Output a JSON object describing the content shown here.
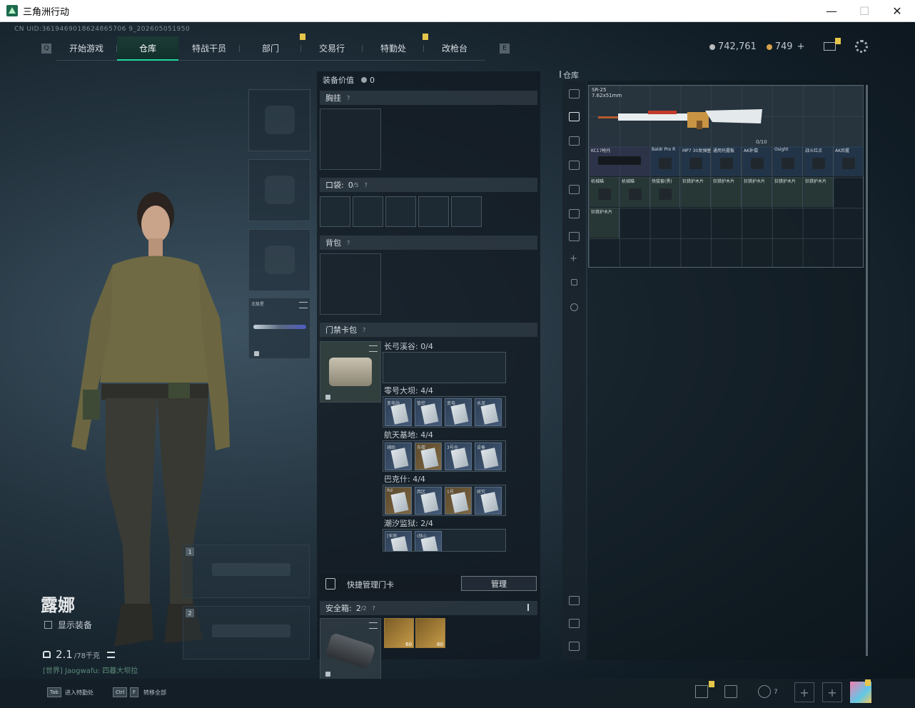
{
  "window": {
    "title": "三角洲行动",
    "min": "—",
    "max": "☐",
    "close": "✕"
  },
  "uid": "CN UID:3619469018624865706 9_202605051950",
  "nav": {
    "left_key": "Q",
    "right_key": "E",
    "tabs": [
      {
        "label": "开始游戏",
        "active": false,
        "badge": false
      },
      {
        "label": "仓库",
        "active": true,
        "badge": false
      },
      {
        "label": "特战干员",
        "active": false,
        "badge": false
      },
      {
        "label": "部门",
        "active": false,
        "badge": true
      },
      {
        "label": "交易行",
        "active": false,
        "badge": false
      },
      {
        "label": "特勤处",
        "active": false,
        "badge": true
      },
      {
        "label": "改枪台",
        "active": false,
        "badge": false
      }
    ]
  },
  "currency": {
    "silver": "742,761",
    "gold": "749",
    "gold_add": "+"
  },
  "character": {
    "name": "露娜",
    "show_equip_label": "显示装备",
    "weight_value": "2.1",
    "weight_unit": "/78千克",
    "chat": "[世界] Jaogwafu: 四暮大坝拉"
  },
  "melee": {
    "label": "北极星"
  },
  "gun_slots": [
    "1",
    "2"
  ],
  "middle": {
    "equip_value_label": "装备价值",
    "equip_value": "0",
    "chest_rig": "胸挂",
    "pocket": "口袋:",
    "pocket_value": "0",
    "pocket_max": "/5",
    "backpack": "背包",
    "keycard_pack": "门禁卡包",
    "help": "?",
    "key_areas": [
      {
        "label": "长弓溪谷: 0/4",
        "cards": []
      },
      {
        "label": "零号大坝: 4/4",
        "cards": [
          "变电站",
          "管控",
          "变电",
          "水泥"
        ]
      },
      {
        "label": "航天基地: 4/4",
        "cards": [
          "辅助",
          "东楼",
          "3号仓",
          "设备"
        ]
      },
      {
        "label": "巴克什: 4/4",
        "cards": [
          "Rd",
          "西区",
          "1号",
          "研究"
        ]
      },
      {
        "label": "潮汐监狱: 2/4",
        "cards": [
          "[牢房",
          "(核心"
        ]
      }
    ],
    "quick_manage": "快捷管理门卡",
    "manage_btn": "管理",
    "safe_box": "安全箱:",
    "safe_box_value": "2",
    "safe_box_max": "/2",
    "ammo": [
      {
        "qty": "60"
      },
      {
        "qty": "60"
      }
    ]
  },
  "warehouse": {
    "title": "仓库",
    "sr25_name": "SR-25",
    "sr25_caliber": "7.62x51mm",
    "sr25_capacity": "0/10",
    "stock_label": "KC17枪托",
    "attachments_row1": [
      "Baldr Pro R",
      "MP7 30发弹匣",
      "通用托握板",
      "AK补偿",
      "Osight",
      "战斗红点",
      "AK后握"
    ],
    "attachments_row2": [
      "机械瞄",
      "机械瞄",
      "快拔套(黑)",
      "狂猎护木片",
      "狂猎护木片",
      "狂猎护木片",
      "狂猎护木片",
      "狂猎护木片"
    ],
    "attachments_row3": [
      "狂猎护木片"
    ],
    "side_add": "+"
  },
  "bottom": {
    "tab_key": "Tab",
    "tab_label": "进入特勤处",
    "ctrl_key": "Ctrl",
    "f_key": "F",
    "ctrl_label": "转移全部",
    "friends_count": "7",
    "plus": "+"
  },
  "colors": {
    "accent": "#26d9a1",
    "badge": "#e6c64a",
    "background": "#0e1a22"
  }
}
